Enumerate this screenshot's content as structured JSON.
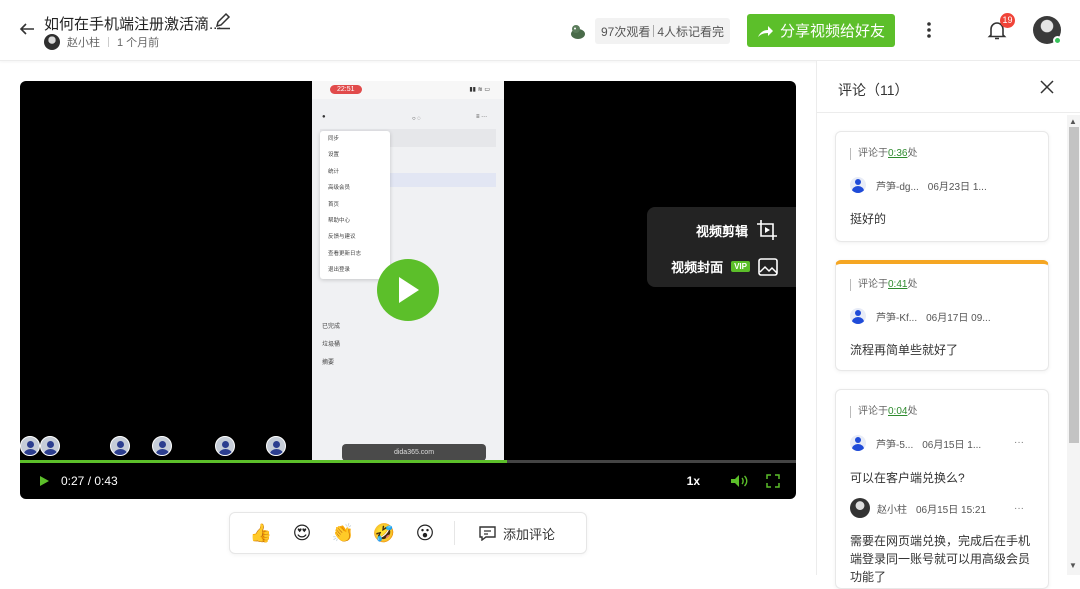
{
  "header": {
    "title": "如何在手机端注册激活滴...",
    "author": "赵小柱",
    "time_ago": "1 个月前",
    "views": "97次观看",
    "watched": "4人标记看完",
    "share_label": "分享视频给好友",
    "notification_count": "19"
  },
  "player": {
    "time": "0:27 / 0:43",
    "progress": 0.628,
    "speed": "1x",
    "edit_label": "视频剪辑",
    "cover_label": "视频封面",
    "vip": "VIP",
    "phone": {
      "status_time": "22:51",
      "menu": [
        "同步",
        "设置",
        "统计",
        "高级会员",
        "首页",
        "帮助中心",
        "反馈与建议",
        "查看更新日志",
        "退出登录"
      ],
      "list": [
        "已完成",
        "垃圾桶",
        "摘要"
      ],
      "url": "dida365.com"
    }
  },
  "reactions": {
    "items": [
      "thumbs-up",
      "heart-eyes",
      "clap",
      "rofl",
      "surprised"
    ],
    "add_comment": "添加评论"
  },
  "comments": {
    "title": "评论（11）",
    "list": [
      {
        "prefix": "评论于",
        "ts": "0:36",
        "suffix": "处",
        "user": "芦笋-dg...",
        "date": "06月23日 1...",
        "text": "挺好的"
      },
      {
        "prefix": "评论于",
        "ts": "0:41",
        "suffix": "处",
        "user": "芦笋-Kf...",
        "date": "06月17日 09...",
        "text": "流程再简单些就好了"
      },
      {
        "prefix": "评论于",
        "ts": "0:04",
        "suffix": "处",
        "user": "芦笋-5...",
        "date": "06月15日 1...",
        "more": "···",
        "text": "可以在客户端兑换么?",
        "reply": {
          "user": "赵小柱",
          "date": "06月15日 15:21",
          "more": "···",
          "text": "需要在网页端兑换，完成后在手机端登录同一账号就可以用高级会员功能了"
        }
      }
    ]
  }
}
